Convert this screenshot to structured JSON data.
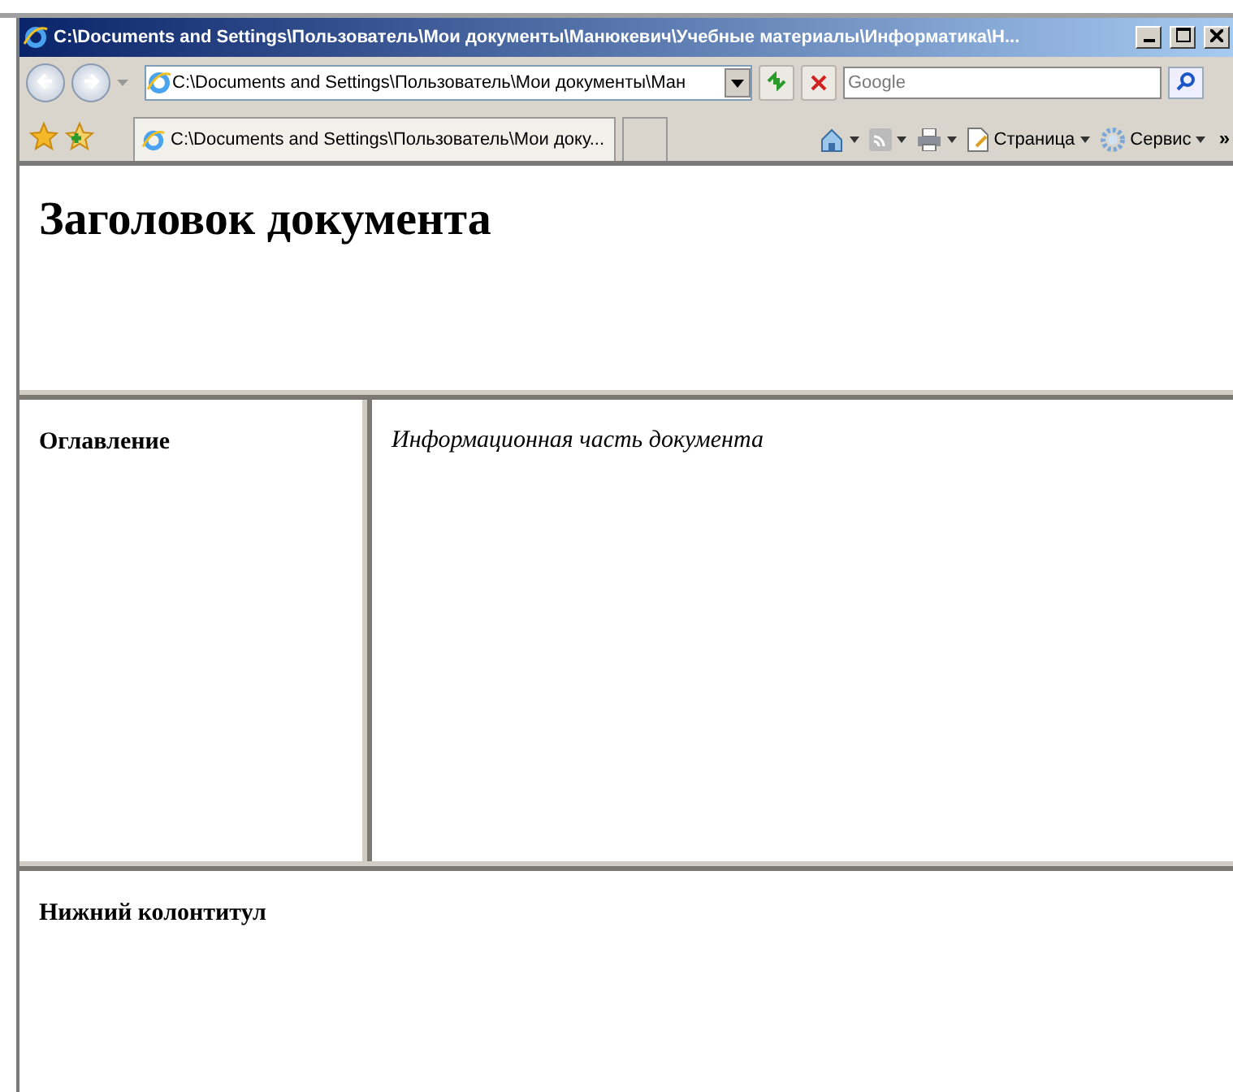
{
  "window": {
    "title": "C:\\Documents and Settings\\Пользователь\\Мои документы\\Манюкевич\\Учебные материалы\\Информатика\\Н..."
  },
  "address_bar": {
    "value": "C:\\Documents and Settings\\Пользователь\\Мои документы\\Ман"
  },
  "search": {
    "placeholder": "Google"
  },
  "tabs": [
    {
      "label": "C:\\Documents and Settings\\Пользователь\\Мои доку...",
      "selected": true
    }
  ],
  "command_bar": {
    "items": [
      {
        "kind": "home"
      },
      {
        "kind": "feeds"
      },
      {
        "kind": "print"
      },
      {
        "kind": "page",
        "label": "Страница"
      },
      {
        "kind": "tools",
        "label": "Сервис"
      }
    ],
    "more": "»"
  },
  "frames": {
    "header": {
      "title": "Заголовок документа"
    },
    "contents": {
      "title": "Оглавление"
    },
    "main": {
      "text": "Информационная часть документа"
    },
    "footer": {
      "title": "Нижний колонтитул"
    }
  }
}
